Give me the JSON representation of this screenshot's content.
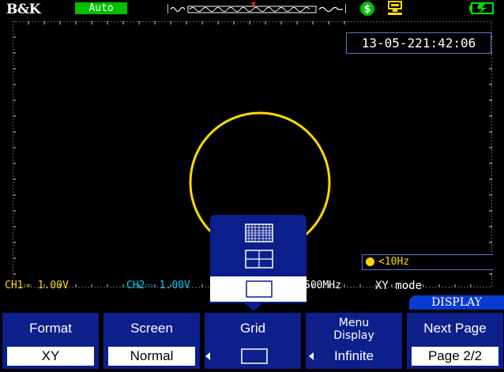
{
  "header": {
    "brand": "B&K",
    "mode": "Auto"
  },
  "datetime": "13-05-221:42:06",
  "frequency": "<10Hz",
  "status": {
    "ch1": "CH1⎓ 1.00V",
    "ch2": "CH2⎓ 1.00V",
    "timebase": "500MHz",
    "xy_mode": "XY mode"
  },
  "menu": {
    "title": "DISPLAY",
    "softkeys": [
      {
        "label": "Format",
        "value": "XY"
      },
      {
        "label": "Screen",
        "value": "Normal"
      },
      {
        "label": "Grid",
        "value": ""
      },
      {
        "label": "Menu Display",
        "value": "Infinite"
      },
      {
        "label": "Next Page",
        "value": "Page 2/2"
      }
    ]
  },
  "grid_popup": {
    "options": [
      "full-grid-icon",
      "cross-grid-icon",
      "no-grid-icon"
    ],
    "selected": "no-grid-icon"
  },
  "colors": {
    "ch1": "#ffd800",
    "ch2": "#00c8ff",
    "softkey_bg": "#0c1f8a",
    "menu_title_bg": "#0a3bd0",
    "mode_bg": "#00c000"
  }
}
